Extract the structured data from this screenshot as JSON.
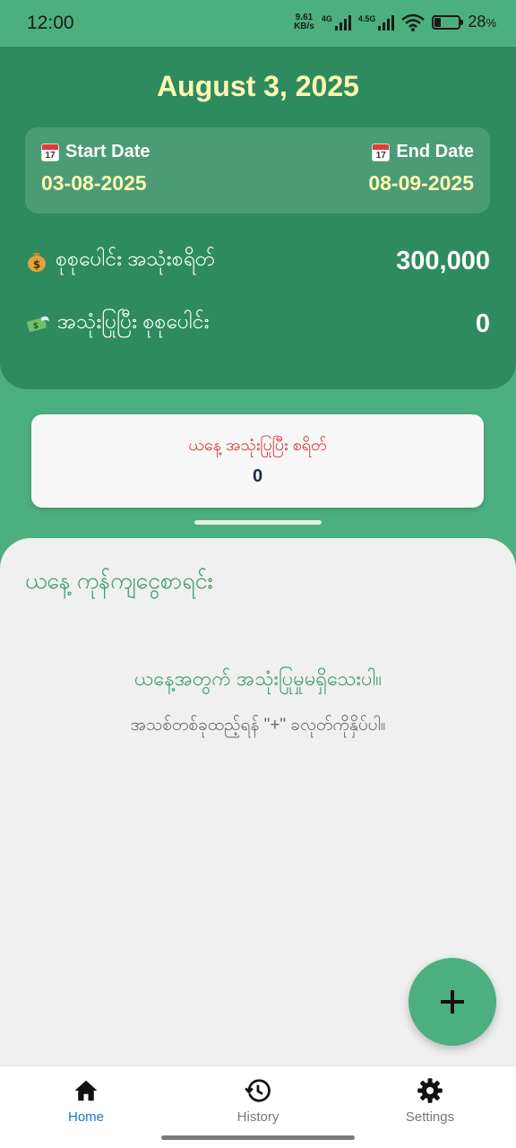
{
  "status_bar": {
    "time": "12:00",
    "net_speed_value": "9.61",
    "net_speed_unit": "KB/s",
    "signal1_label": "4G",
    "signal2_label": "4.5G",
    "battery": "28",
    "battery_unit": "%",
    "battery_level": 0.28
  },
  "header": {
    "date": "August 3, 2025",
    "start_label": "Start Date",
    "start_value": "03-08-2025",
    "end_label": "End Date",
    "end_value": "08-09-2025",
    "calendar_icon_text": "17"
  },
  "stats": {
    "budget_label": "စုစုပေါင်း အသုံးစရိတ်",
    "budget_value": "300,000",
    "spent_label": "အသုံးပြုပြီး စုစုပေါင်း",
    "spent_value": "0"
  },
  "summary": {
    "label": "ယနေ့ အသုံးပြုပြီး စရိတ်",
    "value": "0"
  },
  "sheet": {
    "title": "ယနေ့ ကုန်ကျငွေစာရင်း",
    "empty_main": "ယနေ့အတွက် အသုံးပြုမှုမရှိသေးပါ။",
    "empty_sub": "အသစ်တစ်ခုထည့်ရန် \"+\" ခလုတ်ကိုနှိပ်ပါ။"
  },
  "nav": {
    "home": "Home",
    "history": "History",
    "settings": "Settings"
  },
  "colors": {
    "primary": "#4caf80",
    "header": "#2e8b60",
    "date_highlight": "#fff8b0",
    "active_nav": "#1976d2",
    "warning_text": "#d32f2f"
  }
}
